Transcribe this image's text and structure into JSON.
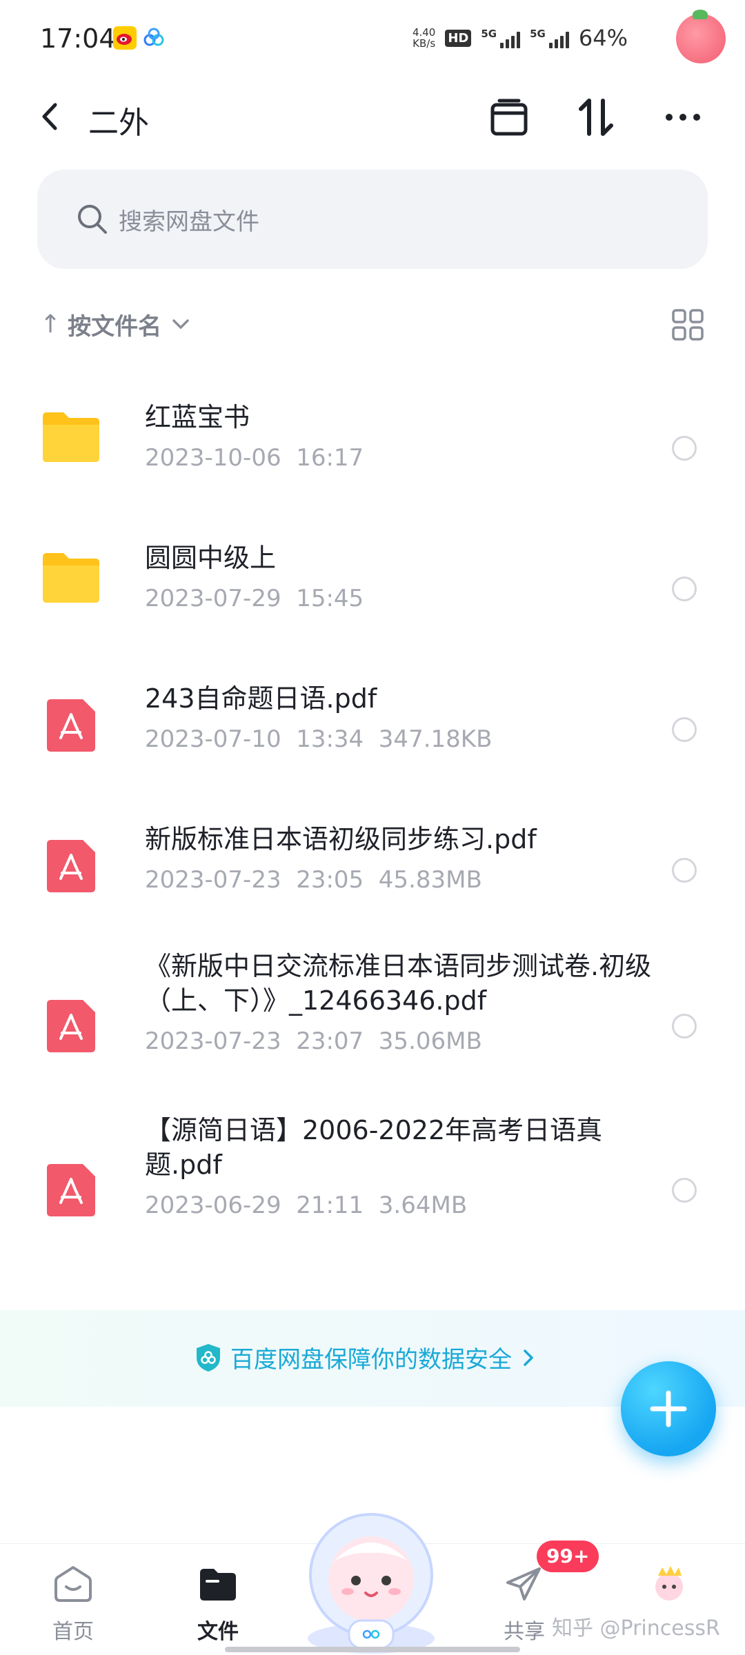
{
  "status_bar": {
    "time": "17:04",
    "net_speed_value": "4.40",
    "net_speed_unit": "KB/s",
    "hd_label": "HD",
    "sim1_tag": "5G",
    "sim2_tag": "5G",
    "battery": "64%"
  },
  "header": {
    "title": "二外"
  },
  "search": {
    "placeholder": "搜索网盘文件"
  },
  "sort": {
    "label": "按文件名"
  },
  "files": [
    {
      "type": "folder",
      "name": "红蓝宝书",
      "meta": "2023-10-06  16:17"
    },
    {
      "type": "folder",
      "name": "圆圆中级上",
      "meta": "2023-07-29  15:45"
    },
    {
      "type": "pdf",
      "name": "243自命题日语.pdf",
      "meta": "2023-07-10  13:34  347.18KB"
    },
    {
      "type": "pdf",
      "name": "新版标准日本语初级同步练习.pdf",
      "meta": "2023-07-23  23:05  45.83MB"
    },
    {
      "type": "pdf",
      "name": "《新版中日交流标准日本语同步测试卷.初级（上、下）》_12466346.pdf",
      "meta": "2023-07-23  23:07  35.06MB"
    },
    {
      "type": "pdf",
      "name": "【源简日语】2006-2022年高考日语真题.pdf",
      "meta": "2023-06-29  21:11  3.64MB"
    }
  ],
  "safety": {
    "text": "百度网盘保障你的数据安全"
  },
  "bottom_nav": {
    "home": "首页",
    "files": "文件",
    "share": "共享",
    "badge": "99+"
  },
  "watermark": "知乎 @PrincessR",
  "colors": {
    "accent": "#16a6f2",
    "folder": "#ffcc33",
    "pdf": "#f2596b",
    "safety_text": "#1aa9d6"
  }
}
